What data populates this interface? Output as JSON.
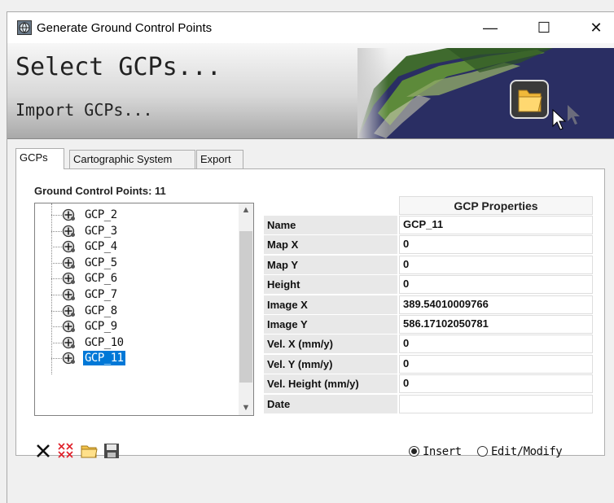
{
  "window": {
    "title": "Generate Ground Control Points",
    "controls": {
      "minimize": "—",
      "maximize": "☐",
      "close": "✕"
    }
  },
  "banner": {
    "select_label": "Select GCPs...",
    "import_label": "Import GCPs..."
  },
  "tabs": [
    {
      "label": "GCPs",
      "active": true
    },
    {
      "label": "Cartographic System",
      "active": false
    },
    {
      "label": "Export",
      "active": false
    }
  ],
  "gcp_list": {
    "label": "Ground Control Points:",
    "count": "11",
    "items": [
      {
        "label": "GCP_2",
        "selected": false
      },
      {
        "label": "GCP_3",
        "selected": false
      },
      {
        "label": "GCP_4",
        "selected": false
      },
      {
        "label": "GCP_5",
        "selected": false
      },
      {
        "label": "GCP_6",
        "selected": false
      },
      {
        "label": "GCP_7",
        "selected": false
      },
      {
        "label": "GCP_8",
        "selected": false
      },
      {
        "label": "GCP_9",
        "selected": false
      },
      {
        "label": "GCP_10",
        "selected": false
      },
      {
        "label": "GCP_11",
        "selected": true
      }
    ]
  },
  "properties": {
    "header": "GCP Properties",
    "rows": [
      {
        "name": "Name",
        "value": "GCP_11"
      },
      {
        "name": "Map X",
        "value": "0"
      },
      {
        "name": "Map Y",
        "value": "0"
      },
      {
        "name": "Height",
        "value": "0"
      },
      {
        "name": "Image X",
        "value": "389.54010009766"
      },
      {
        "name": "Image Y",
        "value": "586.17102050781"
      },
      {
        "name": "Vel. X (mm/y)",
        "value": "0"
      },
      {
        "name": "Vel. Y (mm/y)",
        "value": "0"
      },
      {
        "name": "Vel. Height (mm/y)",
        "value": "0"
      },
      {
        "name": "Date",
        "value": ""
      }
    ]
  },
  "toolbar": {
    "icons": [
      "delete-icon",
      "delete-all-icon",
      "open-folder-icon",
      "save-icon"
    ]
  },
  "mode": {
    "insert_label": "Insert",
    "edit_label": "Edit/Modify",
    "selected": "insert"
  }
}
